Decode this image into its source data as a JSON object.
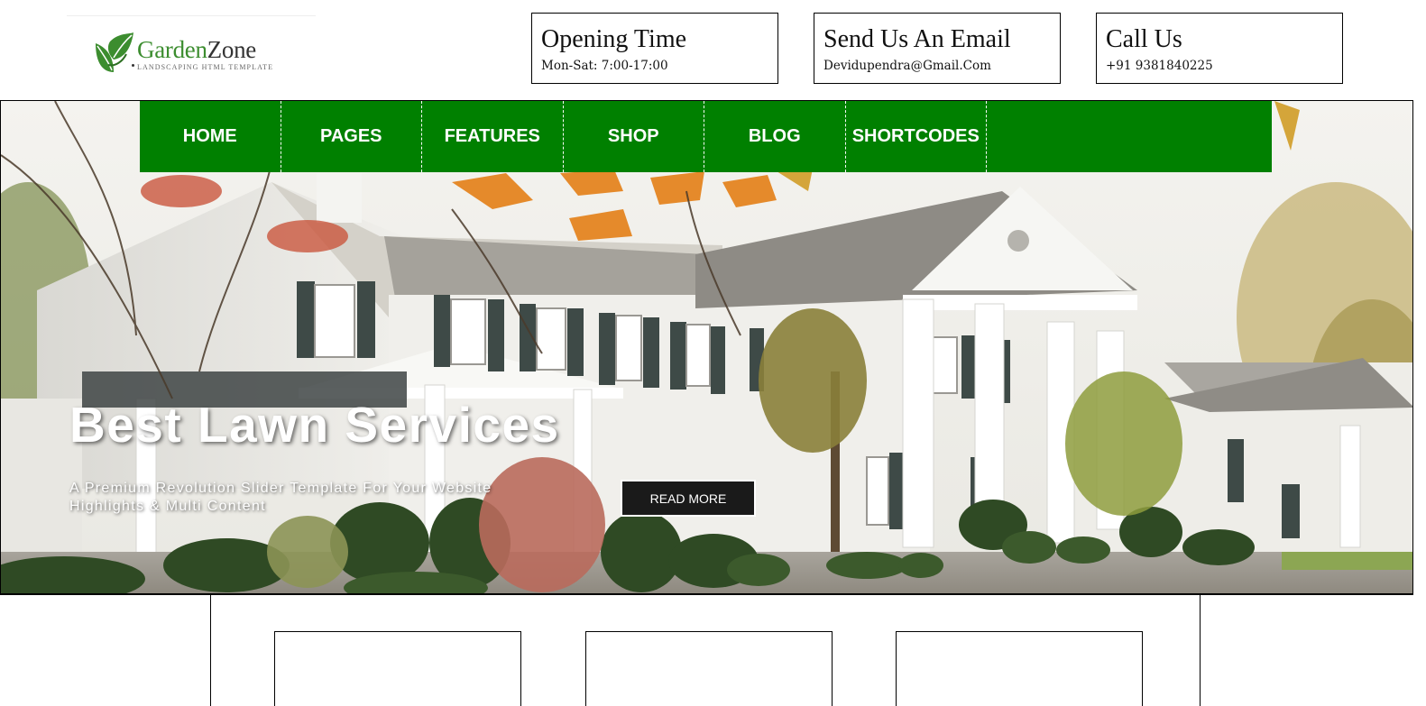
{
  "logo": {
    "name_part1": "Garden",
    "name_part2": "Zone",
    "tagline": "LANDSCAPING HTML TEMPLATE",
    "icon": "leaf-icon",
    "brand_color": "#3c8d2f"
  },
  "header": {
    "info": [
      {
        "title": "Opening Time",
        "value": "Mon-Sat: 7:00-17:00"
      },
      {
        "title": "Send Us An Email",
        "value": "Devidupendra@Gmail.Com"
      },
      {
        "title": "Call Us",
        "value": "+91 9381840225"
      }
    ]
  },
  "nav": {
    "color": "#008000",
    "items": [
      {
        "label": "HOME"
      },
      {
        "label": "PAGES"
      },
      {
        "label": "FEATURES"
      },
      {
        "label": "SHOP"
      },
      {
        "label": "BLOG"
      },
      {
        "label": "SHORTCODES"
      }
    ]
  },
  "hero": {
    "title": "Best Lawn Services",
    "subtitle": "A Premium Revolution Slider Template For Your Website Highlights & Multi Content",
    "button_label": "READ MORE"
  }
}
